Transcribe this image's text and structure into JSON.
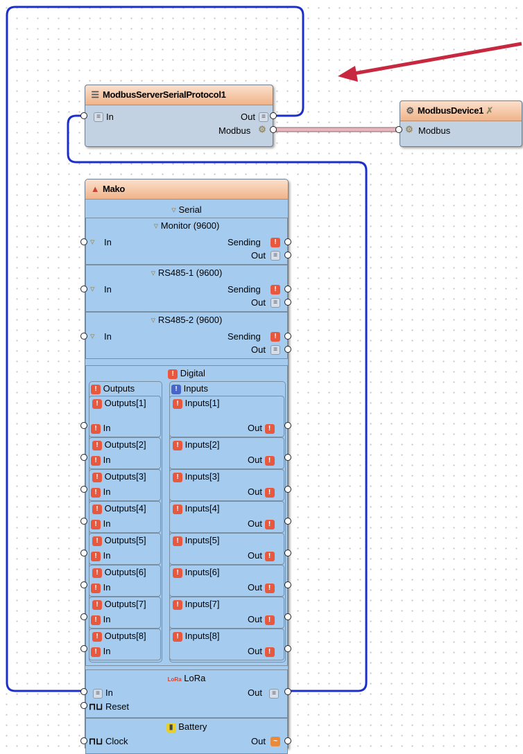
{
  "components": {
    "modbus_server": {
      "title": "ModbusServerSerialProtocol1",
      "in_label": "In",
      "out_label": "Out",
      "modbus_label": "Modbus"
    },
    "modbus_device": {
      "title": "ModbusDevice1",
      "modbus_label": "Modbus"
    },
    "mako": {
      "title": "Mako",
      "serial_label": "Serial",
      "serial_sections": [
        {
          "title": "Monitor (9600)",
          "in": "In",
          "sending": "Sending",
          "out": "Out"
        },
        {
          "title": "RS485-1 (9600)",
          "in": "In",
          "sending": "Sending",
          "out": "Out"
        },
        {
          "title": "RS485-2 (9600)",
          "in": "In",
          "sending": "Sending",
          "out": "Out"
        }
      ],
      "digital_label": "Digital",
      "outputs_label": "Outputs",
      "inputs_label": "Inputs",
      "outputs": [
        {
          "name": "Outputs[1]",
          "pin": "In"
        },
        {
          "name": "Outputs[2]",
          "pin": "In"
        },
        {
          "name": "Outputs[3]",
          "pin": "In"
        },
        {
          "name": "Outputs[4]",
          "pin": "In"
        },
        {
          "name": "Outputs[5]",
          "pin": "In"
        },
        {
          "name": "Outputs[6]",
          "pin": "In"
        },
        {
          "name": "Outputs[7]",
          "pin": "In"
        },
        {
          "name": "Outputs[8]",
          "pin": "In"
        }
      ],
      "inputs": [
        {
          "name": "Inputs[1]",
          "pin": "Out"
        },
        {
          "name": "Inputs[2]",
          "pin": "Out"
        },
        {
          "name": "Inputs[3]",
          "pin": "Out"
        },
        {
          "name": "Inputs[4]",
          "pin": "Out"
        },
        {
          "name": "Inputs[5]",
          "pin": "Out"
        },
        {
          "name": "Inputs[6]",
          "pin": "Out"
        },
        {
          "name": "Inputs[7]",
          "pin": "Out"
        },
        {
          "name": "Inputs[8]",
          "pin": "Out"
        }
      ],
      "lora": {
        "label": "LoRa",
        "icon_text": "LoRa",
        "in": "In",
        "reset": "Reset",
        "out": "Out"
      },
      "battery": {
        "label": "Battery",
        "clock": "Clock",
        "out": "Out"
      }
    }
  },
  "colors": {
    "wire_blue": "#1c2fc9",
    "wire_modbus": "#e8b7bd",
    "arrow_red": "#c8283f",
    "component_fill": "#a5cbee",
    "title_orange": "#f0b48a"
  }
}
